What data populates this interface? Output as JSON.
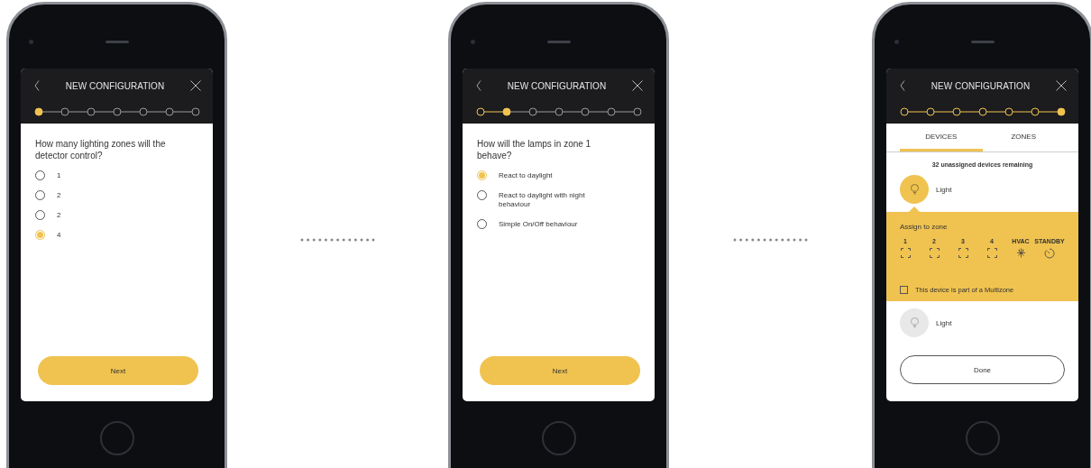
{
  "phones": [
    {
      "kind": "question",
      "title": "NEW CONFIGURATION",
      "steps": [
        {
          "done": false,
          "current": true
        },
        {
          "done": false,
          "current": false
        },
        {
          "done": false,
          "current": false
        },
        {
          "done": false,
          "current": false
        },
        {
          "done": false,
          "current": false
        },
        {
          "done": false,
          "current": false
        },
        {
          "done": false,
          "current": false
        }
      ],
      "question": "How many lighting zones will the detector control?",
      "options": [
        {
          "label": "1",
          "selected": false
        },
        {
          "label": "2",
          "selected": false
        },
        {
          "label": "2",
          "selected": false
        },
        {
          "label": "4",
          "selected": true
        }
      ],
      "button": "Next"
    },
    {
      "kind": "question",
      "title": "NEW CONFIGURATION",
      "steps": [
        {
          "done": true,
          "current": false
        },
        {
          "done": false,
          "current": true
        },
        {
          "done": false,
          "current": false
        },
        {
          "done": false,
          "current": false
        },
        {
          "done": false,
          "current": false
        },
        {
          "done": false,
          "current": false
        },
        {
          "done": false,
          "current": false
        }
      ],
      "question": "How will the lamps in zone 1 behave?",
      "options": [
        {
          "label": "React to daylight",
          "selected": true
        },
        {
          "label": "React to daylight with night behaviour",
          "selected": false
        },
        {
          "label": "Simple On/Off behaviour",
          "selected": false
        }
      ],
      "button": "Next"
    },
    {
      "kind": "devices",
      "title": "NEW CONFIGURATION",
      "steps": [
        {
          "done": true,
          "current": false
        },
        {
          "done": true,
          "current": false
        },
        {
          "done": true,
          "current": false
        },
        {
          "done": true,
          "current": false
        },
        {
          "done": true,
          "current": false
        },
        {
          "done": true,
          "current": false
        },
        {
          "done": false,
          "current": true
        }
      ],
      "tabs": [
        {
          "label": "DEVICES",
          "selected": true
        },
        {
          "label": "ZONES",
          "selected": false
        }
      ],
      "remaining": "32 unassigned devices remaining",
      "devices": [
        {
          "name": "Light",
          "expanded": true
        },
        {
          "name": "Light",
          "expanded": false
        }
      ],
      "assign": {
        "title": "Assign to zone",
        "zones": [
          {
            "label": "1",
            "kind": "zone"
          },
          {
            "label": "2",
            "kind": "zone"
          },
          {
            "label": "3",
            "kind": "zone"
          },
          {
            "label": "4",
            "kind": "zone"
          },
          {
            "label": "HVAC",
            "kind": "hvac"
          },
          {
            "label": "STANDBY",
            "kind": "standby"
          }
        ],
        "multizone": {
          "label": "This device is part of a Multizone",
          "checked": false
        }
      },
      "button": "Done"
    }
  ]
}
